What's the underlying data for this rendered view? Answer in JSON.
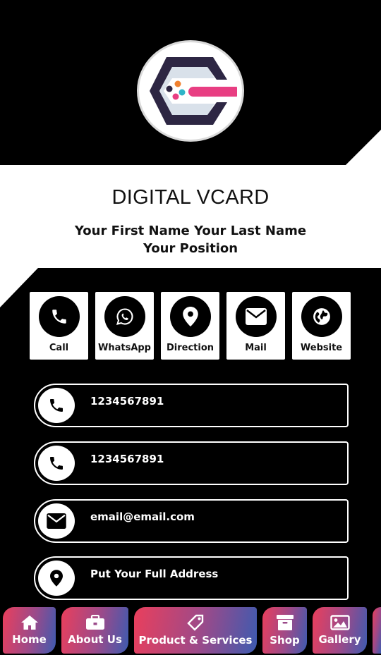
{
  "header": {
    "logo_icon": "hexagon-pill-logo-icon"
  },
  "title": {
    "brand": "DIGITAL VCARD",
    "name": "Your First Name Your Last Name",
    "position": "Your Position"
  },
  "actions": [
    {
      "label": "Call",
      "icon": "phone-icon"
    },
    {
      "label": "WhatsApp",
      "icon": "whatsapp-icon"
    },
    {
      "label": "Direction",
      "icon": "map-pin-icon"
    },
    {
      "label": "Mail",
      "icon": "envelope-icon"
    },
    {
      "label": "Website",
      "icon": "globe-icon"
    }
  ],
  "contacts": [
    {
      "text": "1234567891",
      "icon": "phone-icon"
    },
    {
      "text": "1234567891",
      "icon": "phone-icon"
    },
    {
      "text": "email@email.com",
      "icon": "envelope-icon"
    },
    {
      "text": "Put Your Full Address",
      "icon": "map-pin-icon"
    }
  ],
  "nav": [
    {
      "label": "Home",
      "icon": "home-icon"
    },
    {
      "label": "About Us",
      "icon": "briefcase-icon"
    },
    {
      "label": "Product & Services",
      "icon": "tag-icon"
    },
    {
      "label": "Shop",
      "icon": "archive-box-icon"
    },
    {
      "label": "Gallery",
      "icon": "image-icon"
    }
  ],
  "colors": {
    "background": "#000000",
    "card": "#ffffff",
    "nav_gradient_start": "#ea3f5c",
    "nav_gradient_end": "#3d5bb0",
    "logo_pink": "#e83e82",
    "logo_dark": "#2d2643"
  }
}
